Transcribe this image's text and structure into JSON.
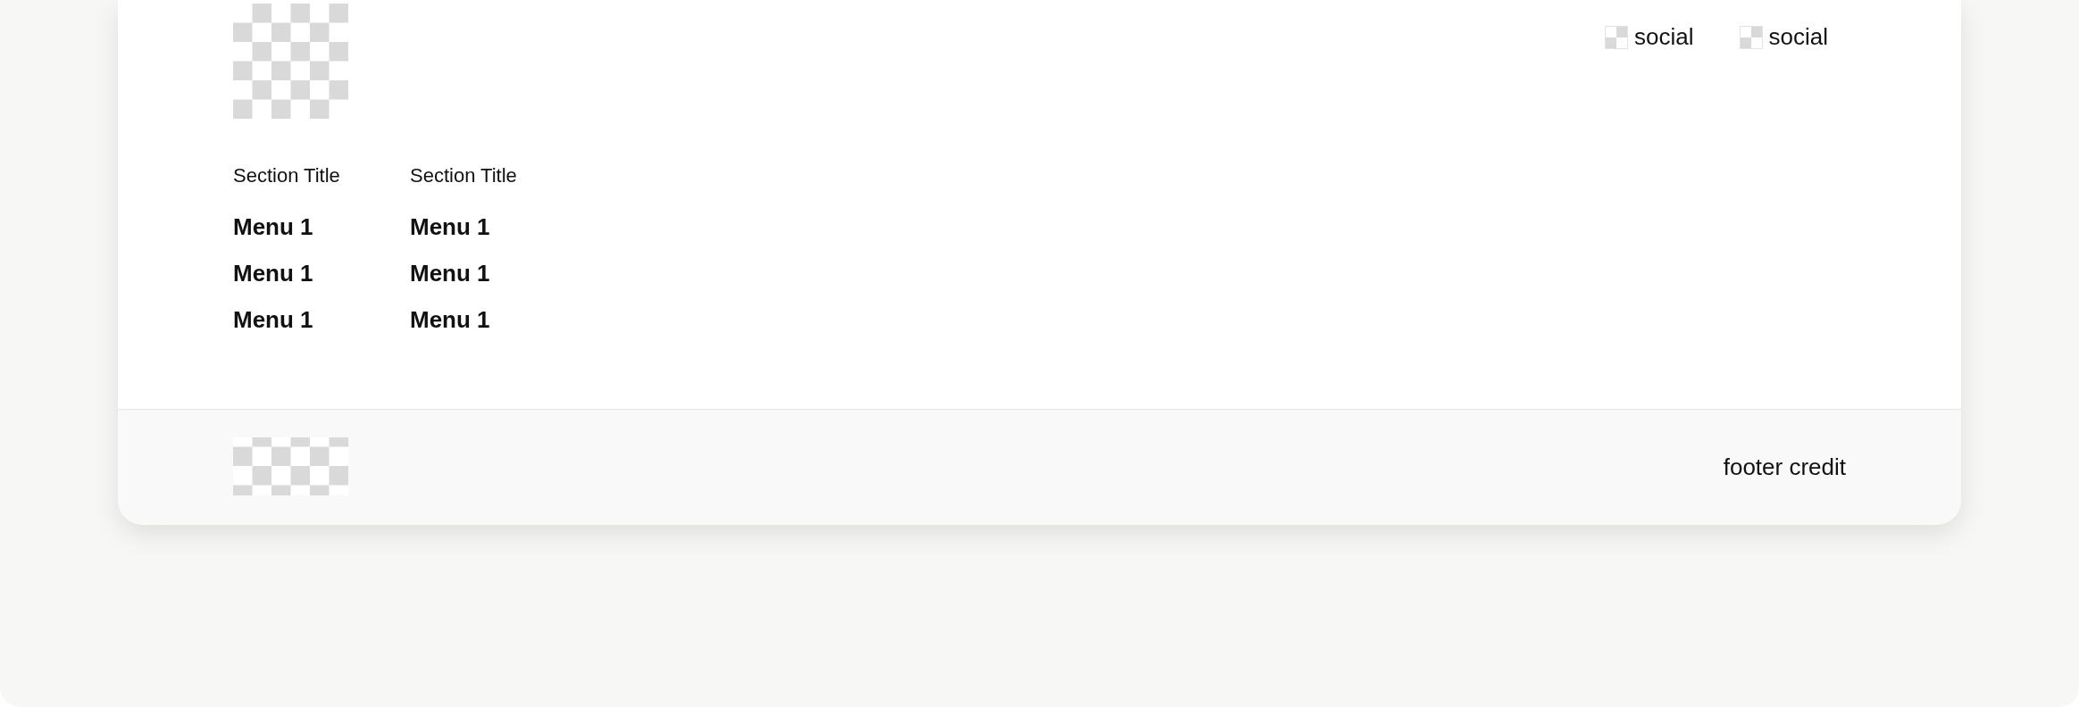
{
  "header": {
    "social_links": [
      {
        "label": "social"
      },
      {
        "label": "social"
      }
    ]
  },
  "sections": [
    {
      "title": "Section Title",
      "items": [
        "Menu 1",
        "Menu 1",
        "Menu 1"
      ]
    },
    {
      "title": "Section Title",
      "items": [
        "Menu 1",
        "Menu 1",
        "Menu 1"
      ]
    }
  ],
  "footer": {
    "credit": "footer credit"
  }
}
